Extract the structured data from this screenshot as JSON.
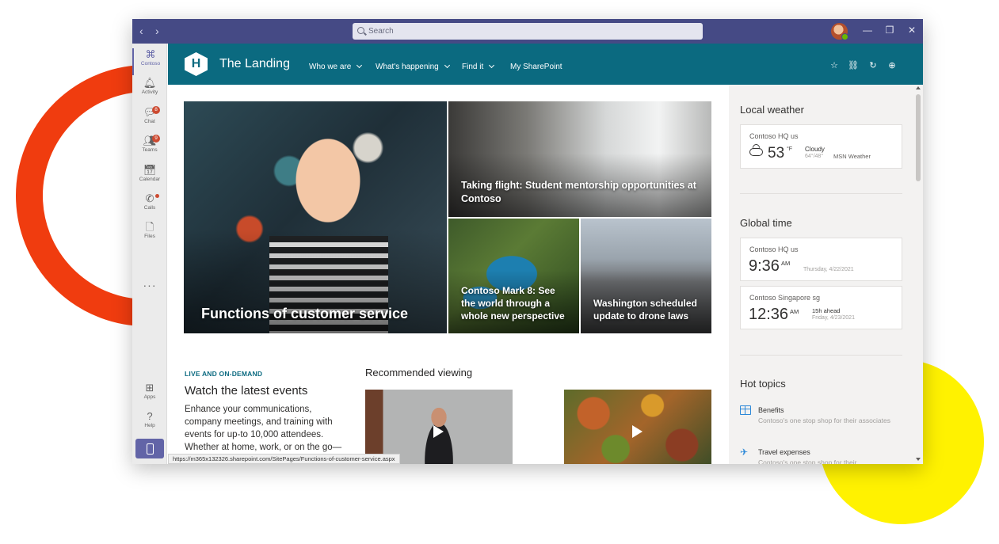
{
  "titlebar": {
    "search_placeholder": "Search",
    "back_icon": "chevron-left-icon",
    "forward_icon": "chevron-right-icon",
    "controls": {
      "minimize": "—",
      "restore": "❐",
      "close": "✕"
    }
  },
  "rail": {
    "items": [
      {
        "label": "Contoso",
        "icon": "contoso-icon",
        "glyph": "⌘"
      },
      {
        "label": "Activity",
        "icon": "bell-icon",
        "glyph": "🔔︎"
      },
      {
        "label": "Chat",
        "icon": "chat-icon",
        "glyph": "💬︎",
        "badge": "8"
      },
      {
        "label": "Teams",
        "icon": "teams-icon",
        "glyph": "👥︎",
        "badge": "9"
      },
      {
        "label": "Calendar",
        "icon": "calendar-icon",
        "glyph": "📅︎"
      },
      {
        "label": "Calls",
        "icon": "phone-icon",
        "glyph": "✆"
      },
      {
        "label": "Files",
        "icon": "file-icon",
        "glyph": "🗋"
      }
    ],
    "more": "···",
    "apps_label": "Apps",
    "apps_glyph": "⊞",
    "help_label": "Help",
    "help_glyph": "?"
  },
  "site": {
    "logo_letter": "H",
    "title": "The Landing",
    "nav": [
      "Who we are",
      "What's happening",
      "Find it",
      "My SharePoint"
    ],
    "actions": {
      "star": "☆",
      "link": "⛓",
      "sync": "↻",
      "globe": "⊕"
    }
  },
  "hero": {
    "main": "Functions of customer service",
    "flight": "Taking flight: Student mentorship opportunities at Contoso",
    "mark": "Contoso Mark 8: See the world through a whole new perspective",
    "washington": "Washington scheduled update to drone laws"
  },
  "events": {
    "kicker": "LIVE AND ON-DEMAND",
    "title": "Watch the latest events",
    "body": "Enhance your communications, company meetings, and training with events for up-to 10,000 attendees. Whether at home, work, or on the go—"
  },
  "recommended": {
    "title": "Recommended viewing"
  },
  "status_url": "https://m365x132326.sharepoint.com/SitePages/Functions-of-customer-service.aspx",
  "weather": {
    "title": "Local weather",
    "location": "Contoso HQ us",
    "temp": "53",
    "unit": "°F",
    "condition": "Cloudy",
    "range": "64°/48°",
    "source": "MSN Weather"
  },
  "global_time": {
    "title": "Global time",
    "clocks": [
      {
        "location": "Contoso HQ us",
        "time": "9:36",
        "ampm": "AM",
        "date": "Thursday, 4/22/2021",
        "ahead": ""
      },
      {
        "location": "Contoso Singapore sg",
        "time": "12:36",
        "ampm": "AM",
        "date": "Friday, 4/23/2021",
        "ahead": "15h ahead"
      }
    ]
  },
  "hot_topics": {
    "title": "Hot topics",
    "items": [
      {
        "label": "Benefits",
        "desc": "Contoso's one stop shop for their associates",
        "icon": "gift-icon"
      },
      {
        "label": "Travel expenses",
        "desc": "Contoso's one stop shop for their",
        "icon": "airplane-icon"
      }
    ]
  },
  "colors": {
    "teams_purple": "#454a85",
    "site_teal": "#0b6a80",
    "deco_red": "#f03c0f",
    "deco_yellow": "#fff200"
  }
}
